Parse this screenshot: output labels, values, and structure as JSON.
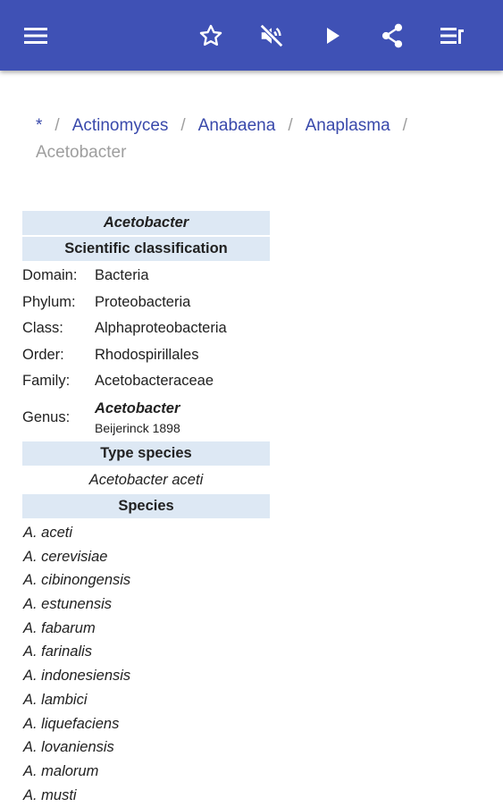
{
  "appbar": {
    "color": "#3f51b5",
    "icons": [
      "menu-icon",
      "star-icon",
      "volume-off-icon",
      "play-icon",
      "share-icon",
      "playlist-icon"
    ]
  },
  "breadcrumb": {
    "items": [
      "*",
      "Actinomyces",
      "Anabaena",
      "Anaplasma"
    ],
    "separator": "/",
    "current": "Acetobacter"
  },
  "infobox": {
    "title": "Acetobacter",
    "classification_header": "Scientific classification",
    "rows": [
      {
        "label": "Domain:",
        "value": "Bacteria"
      },
      {
        "label": "Phylum:",
        "value": "Proteobacteria"
      },
      {
        "label": "Class:",
        "value": "Alphaproteobacteria"
      },
      {
        "label": "Order:",
        "value": "Rhodospirillales"
      },
      {
        "label": "Family:",
        "value": "Acetobacteraceae"
      }
    ],
    "genus": {
      "label": "Genus:",
      "name": "Acetobacter",
      "authority": "Beijerinck 1898"
    },
    "type_species_header": "Type species",
    "type_species": "Acetobacter aceti",
    "species_header": "Species"
  },
  "species": [
    "A. aceti",
    "A. cerevisiae",
    "A. cibinongensis",
    "A. estunensis",
    "A. fabarum",
    "A. farinalis",
    "A. indonesiensis",
    "A. lambici",
    "A. liquefaciens",
    "A. lovaniensis",
    "A. malorum",
    "A. musti"
  ]
}
